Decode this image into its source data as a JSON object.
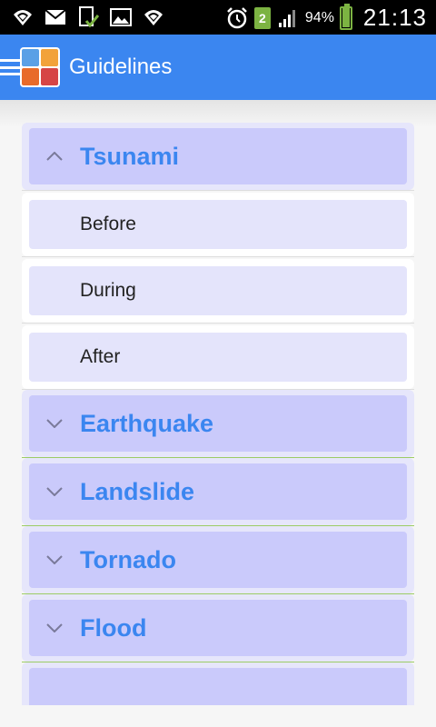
{
  "status_bar": {
    "icons": [
      "wifi-icon",
      "mail-icon",
      "download-check-icon",
      "image-icon",
      "wifi-alt-icon",
      "alarm-icon"
    ],
    "notification_count": "2",
    "battery_percent": "94%",
    "battery_level": 0.94,
    "time": "21:13"
  },
  "app_bar": {
    "title": "Guidelines",
    "accent_color": "#3b86f0"
  },
  "list": {
    "expanded_group": {
      "label": "Tsunami",
      "children": [
        "Before",
        "During",
        "After"
      ]
    },
    "collapsed_groups": [
      "Earthquake",
      "Landslide",
      "Tornado",
      "Flood"
    ]
  }
}
